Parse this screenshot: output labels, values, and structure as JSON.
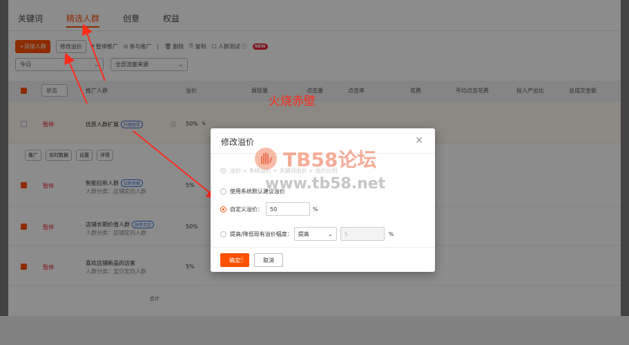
{
  "tabs": [
    {
      "label": "关键词"
    },
    {
      "label": "精选人群"
    },
    {
      "label": "创意"
    },
    {
      "label": "权益"
    }
  ],
  "toolbar": {
    "add_label": "+添加人群",
    "modify_label": "修改溢价",
    "pause_label": "暂停推广",
    "join_label": "参与推广",
    "delete_label": "删除",
    "copy_label": "复制",
    "test_label": "人群测试",
    "new_badge": "NEW"
  },
  "filters": {
    "date": "今日",
    "source": "全部流量来源"
  },
  "table": {
    "headers": [
      "状态",
      "推广人群",
      "溢价",
      "展现量",
      "点击量",
      "点击率",
      "花费",
      "平均点击花费",
      "投入产出比",
      "总成交金额"
    ],
    "rows": [
      {
        "status": "暂停",
        "name": "优质人群扩展",
        "tag": "升级助手",
        "sub": "",
        "pct": "50%"
      },
      {
        "status": "暂停",
        "name": "智能拉新人群",
        "tag": "拉新助推",
        "sub": "人群分类：店铺定向人群",
        "pct": "5%"
      },
      {
        "status": "暂停",
        "name": "店铺长期价值人群",
        "tag": "财务沉淀",
        "sub": "人群分类：店铺定向人群",
        "pct": "50%"
      },
      {
        "status": "暂停",
        "name": "喜欢店铺新品的访客",
        "tag": "",
        "sub": "人群分类：宝贝定向人群",
        "pct": "5%"
      }
    ],
    "row_actions": [
      "推广",
      "实时数据",
      "设置",
      "详情"
    ],
    "total_label": "合计"
  },
  "modal": {
    "title": "修改溢价",
    "opt1": "溢价 = 系统溢价 + 关键词出价 × 溢价比例",
    "opt2": "使用系统默认建议溢价",
    "opt3": "自定义溢价：",
    "opt3_value": "50",
    "opt3_unit": "%",
    "opt4": "提高/降低现有溢价幅度：",
    "opt4_select": "提高",
    "opt4_value": "5",
    "opt4_unit": "%",
    "ok_label": "确定",
    "cancel_label": "取消"
  },
  "watermark": {
    "red_text": "火烧赤壁",
    "logo_text": "TB58论坛",
    "url": "www.tb58.net"
  },
  "colors": {
    "accent": "#ff5000",
    "status_red": "#e8232f",
    "annotation_red": "#ff2a1a"
  }
}
